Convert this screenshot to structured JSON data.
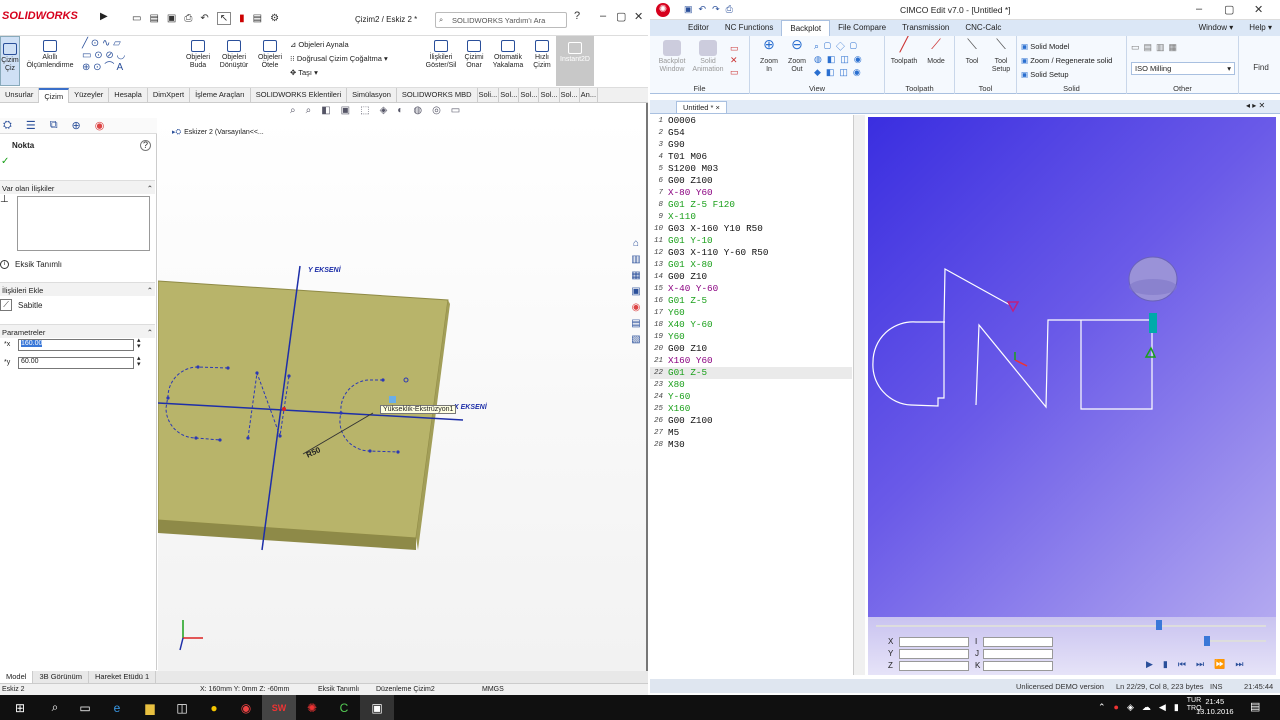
{
  "solidworks": {
    "logo": "SOLIDWORKS",
    "doc_title": "Çizim2 / Eskiz 2 *",
    "search_placeholder": "SOLIDWORKS Yardım'ı Ara",
    "ribbon": [
      {
        "label": "Çizim\nÇiz"
      },
      {
        "label": "Akıllı\nÖlçümlendirme"
      },
      {
        "label": "Objeleri\nBuda"
      },
      {
        "label": "Objeleri\nDönüştür"
      },
      {
        "label": "Objeleri\nÖtele"
      },
      {
        "label": "İlişkileri\nGöster/Sil"
      },
      {
        "label": "Çizimi\nOnar"
      },
      {
        "label": "Otomatik\nYakalama"
      },
      {
        "label": "Hızlı\nÇizim"
      },
      {
        "label": "Instant2D"
      }
    ],
    "ribbon_small": [
      "Objeleri Aynala",
      "Doğrusal Çizim Çoğaltma",
      "Taşı"
    ],
    "tabs": [
      "Unsurlar",
      "Çizim",
      "Yüzeyler",
      "Hesapla",
      "DimXpert",
      "İşleme Araçları",
      "SOLIDWORKS Eklentileri",
      "Simülasyon",
      "SOLIDWORKS MBD",
      "Soli...",
      "Sol...",
      "Sol...",
      "Sol...",
      "Sol...",
      "An..."
    ],
    "active_tab": "Çizim",
    "tree_root": "Eskizer 2  (Varsayılan<<...",
    "panel": {
      "title": "Nokta",
      "existing_relations": "Var olan İlişkiler",
      "under_defined": "Eksik Tanımlı",
      "add_relations": "İlişkileri Ekle",
      "fix": "Sabitle",
      "parameters": "Parametreler",
      "x_value": "160.00",
      "y_value": "60.00"
    },
    "canvas": {
      "y_axis_label": "Y EKSENİ",
      "x_axis_label": "X EKSENİ",
      "dim_label": "R50",
      "tooltip": "Yükseklik-Ekstrüzyon1"
    },
    "bottom_tabs": [
      "Model",
      "3B Görünüm",
      "Hareket Etüdü 1"
    ],
    "status": {
      "left": "Eskiz 2",
      "coords": "X: 160mm Y: 0mm Z: -60mm",
      "state": "Eksik Tanımlı",
      "mode": "Düzenleme Çizim2",
      "units": "MMGS"
    }
  },
  "cimco": {
    "title": "CIMCO Edit v7.0 - [Untitled *]",
    "tabs": [
      "Editor",
      "NC Functions",
      "Backplot",
      "File Compare",
      "Transmission",
      "CNC-Calc"
    ],
    "active_tab": "Backplot",
    "window_menu": "Window",
    "help_menu": "Help",
    "groups": {
      "file": "File",
      "view": "View",
      "toolpath": "Toolpath",
      "tool": "Tool",
      "solid": "Solid",
      "other": "Other"
    },
    "buttons": {
      "backplot_window": "Backplot\nWindow",
      "solid_animation": "Solid\nAnimation",
      "zoom_in": "Zoom\nIn",
      "zoom_out": "Zoom\nOut",
      "toolpath": "Toolpath",
      "mode": "Mode",
      "tool": "Tool",
      "tool_setup": "Tool\nSetup",
      "solid_model": "Solid Model",
      "zoom_regen": "Zoom / Regenerate solid",
      "solid_setup": "Solid Setup",
      "machine": "ISO Milling",
      "find": "Find"
    },
    "doc_tab": "Untitled *",
    "code": [
      {
        "n": "1",
        "t": "O0006",
        "c": "#111"
      },
      {
        "n": "2",
        "t": "G54",
        "c": "#111"
      },
      {
        "n": "3",
        "t": "G90",
        "c": "#111"
      },
      {
        "n": "4",
        "t": "T01 M06",
        "c": "#111"
      },
      {
        "n": "5",
        "t": "S1200 M03",
        "c": "#111"
      },
      {
        "n": "6",
        "t": "G00 Z100",
        "c": "#111"
      },
      {
        "n": "7",
        "t": "X-80 Y60",
        "c": "#8a0080"
      },
      {
        "n": "8",
        "t": "G01 Z-5 F120",
        "c": "#1aa01a"
      },
      {
        "n": "9",
        "t": "X-110",
        "c": "#1aa01a"
      },
      {
        "n": "10",
        "t": "G03 X-160 Y10 R50",
        "c": "#111"
      },
      {
        "n": "11",
        "t": "G01 Y-10",
        "c": "#1aa01a"
      },
      {
        "n": "12",
        "t": "G03 X-110 Y-60 R50",
        "c": "#111"
      },
      {
        "n": "13",
        "t": "G01 X-80",
        "c": "#1aa01a"
      },
      {
        "n": "14",
        "t": "G00 Z10",
        "c": "#111"
      },
      {
        "n": "15",
        "t": "X-40 Y-60",
        "c": "#8a0080"
      },
      {
        "n": "16",
        "t": "G01 Z-5",
        "c": "#1aa01a"
      },
      {
        "n": "17",
        "t": "Y60",
        "c": "#1aa01a"
      },
      {
        "n": "18",
        "t": "X40 Y-60",
        "c": "#1aa01a"
      },
      {
        "n": "19",
        "t": "Y60",
        "c": "#1aa01a"
      },
      {
        "n": "20",
        "t": "G00 Z10",
        "c": "#111"
      },
      {
        "n": "21",
        "t": "X160 Y60",
        "c": "#8a0080"
      },
      {
        "n": "22",
        "t": "G01 Z-5",
        "c": "#1aa01a"
      },
      {
        "n": "23",
        "t": "X80",
        "c": "#1aa01a"
      },
      {
        "n": "24",
        "t": "Y-60",
        "c": "#1aa01a"
      },
      {
        "n": "25",
        "t": "X160",
        "c": "#1aa01a"
      },
      {
        "n": "26",
        "t": "G00 Z100",
        "c": "#111"
      },
      {
        "n": "27",
        "t": "M5",
        "c": "#111"
      },
      {
        "n": "28",
        "t": "M30",
        "c": "#111"
      }
    ],
    "highlight_line": "22",
    "coord_labels": [
      "X",
      "Y",
      "Z",
      "I",
      "J",
      "K"
    ],
    "status_left": "Unlicensed DEMO version",
    "status_pos": "Ln 22/29, Col 8, 223 bytes",
    "status_ins": "INS",
    "status_time": "21:45:44"
  },
  "taskbar": {
    "lang": "TUR\nTRQ",
    "time": "21:45",
    "date": "13.10.2016"
  }
}
